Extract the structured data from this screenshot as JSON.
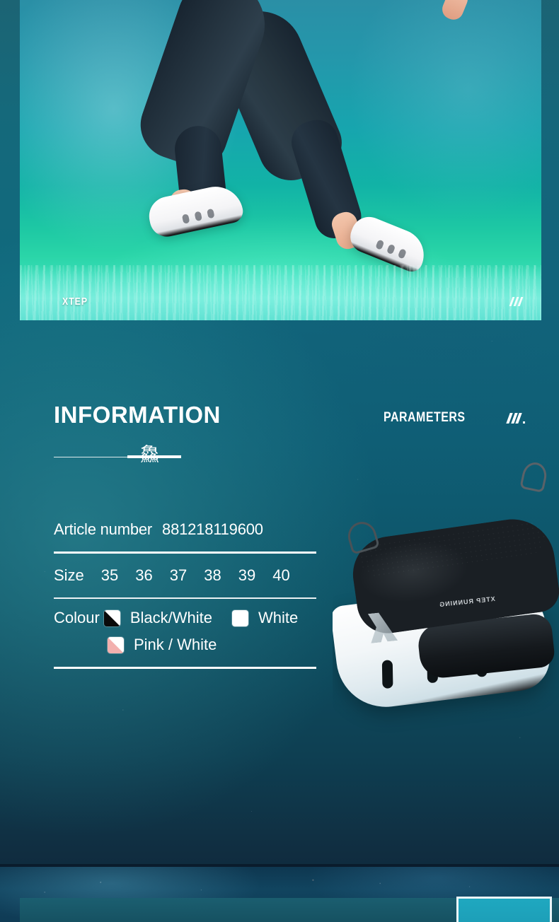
{
  "brand": {
    "name": "XTEP",
    "logo_mark": "three-slash-mark"
  },
  "hero": {
    "alt": "woman-running-over-water",
    "brand_label": "XTEP",
    "logo_mark": "xtep-slash-logo"
  },
  "sections": {
    "information_title": "INFORMATION",
    "parameters_title": "PARAMETERS",
    "deco_glyph": "鱻"
  },
  "spec": {
    "article": {
      "label": "Article number",
      "value": "881218119600"
    },
    "size": {
      "label": "Size",
      "values": [
        "35",
        "36",
        "37",
        "38",
        "39",
        "40"
      ]
    },
    "colour": {
      "label": "Colour",
      "options": [
        {
          "name": "Black/White",
          "swatch": "black-white",
          "primary": "#0a0a0a",
          "secondary": "#ffffff"
        },
        {
          "name": "White",
          "swatch": "white",
          "primary": "#ffffff",
          "secondary": "#ffffff"
        },
        {
          "name": "Pink / White",
          "swatch": "pink-white",
          "primary": "#f2b0ae",
          "secondary": "#ffffff"
        }
      ]
    }
  },
  "product": {
    "alt": "xtep-black-white-running-shoe",
    "side_text": "XTEP RUNNING"
  },
  "colors": {
    "page_bg_top": "#1c6474",
    "page_bg_bottom": "#0c2436",
    "hero_top": "#2a8fa6",
    "hero_bottom": "#73e8da",
    "text": "#ffffff",
    "accent_panel": "#1fa8c0",
    "next_section_bg": "#11445f"
  }
}
